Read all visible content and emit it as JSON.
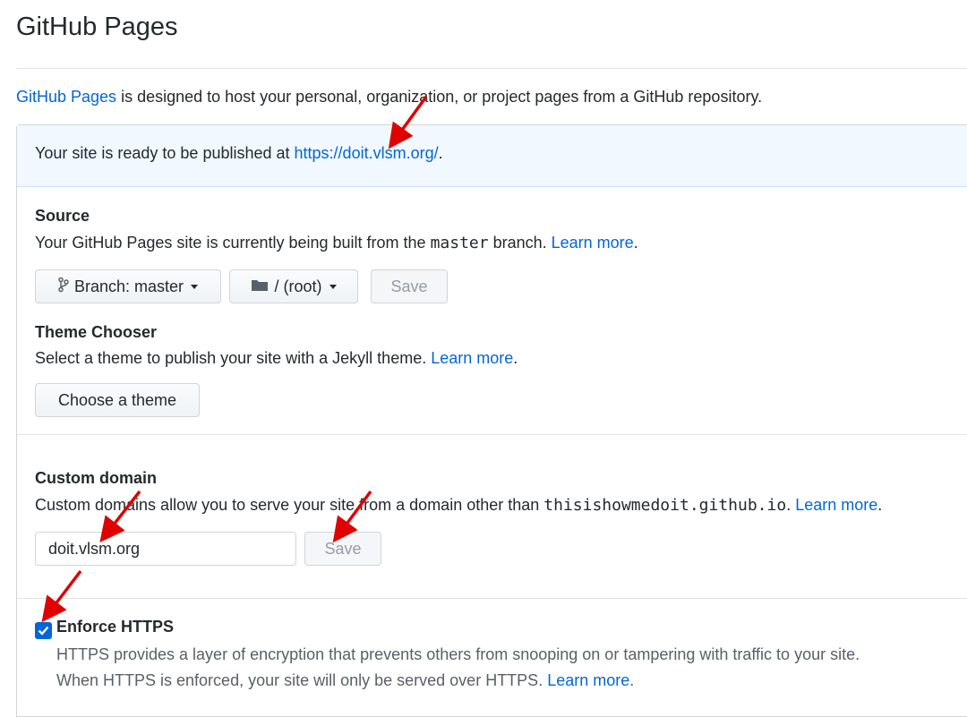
{
  "header": {
    "title": "GitHub Pages"
  },
  "intro": {
    "link": "GitHub Pages",
    "text": " is designed to host your personal, organization, or project pages from a GitHub repository."
  },
  "flash": {
    "text": "Your site is ready to be published at ",
    "url": "https://doit.vlsm.org/",
    "suffix": "."
  },
  "source": {
    "heading": "Source",
    "desc_pre": "Your GitHub Pages site is currently being built from the ",
    "branch_code": "master",
    "desc_post": " branch. ",
    "learn_more": "Learn more",
    "period": ".",
    "branch_button": "Branch: master",
    "folder_button": "/ (root)",
    "save_button": "Save",
    "icons": [
      "branch-icon",
      "folder-icon",
      "caret-down-icon"
    ]
  },
  "theme": {
    "heading": "Theme Chooser",
    "desc": "Select a theme to publish your site with a Jekyll theme. ",
    "learn_more": "Learn more",
    "period": ".",
    "button": "Choose a theme"
  },
  "custom_domain": {
    "heading": "Custom domain",
    "desc_pre": "Custom domains allow you to serve your site from a domain other than ",
    "domain_code": "thisishowmedoit.github.io",
    "desc_post": ". ",
    "learn_more": "Learn more",
    "period": ".",
    "input_value": "doit.vlsm.org",
    "save_button": "Save"
  },
  "https": {
    "heading": "Enforce HTTPS",
    "checked": true,
    "line1": "HTTPS provides a layer of encryption that prevents others from snooping on or tampering with traffic to your site.",
    "line2": "When HTTPS is enforced, your site will only be served over HTTPS. ",
    "learn_more": "Learn more",
    "period": "."
  },
  "colors": {
    "link": "#0366d6",
    "flash_bg": "#f1f8ff",
    "checkbox": "#0366d6",
    "arrow": "#e00000"
  }
}
